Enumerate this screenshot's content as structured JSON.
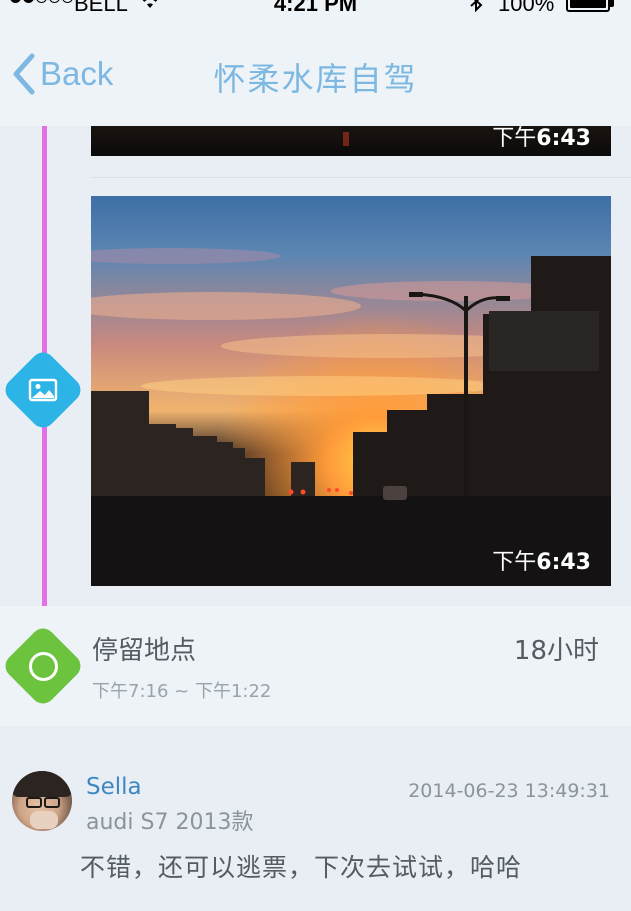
{
  "status_bar": {
    "carrier": "BELL",
    "time": "4:21 PM",
    "battery": "100%"
  },
  "nav": {
    "back_label": "Back",
    "title": "怀柔水库自驾"
  },
  "timeline": {
    "prev_photo": {
      "time_prefix": "下午",
      "time": "6:43"
    },
    "photo": {
      "time_prefix": "下午",
      "time": "6:43"
    },
    "stop": {
      "title": "停留地点",
      "duration": "18小时",
      "range": "下午7:16 ~ 下午1:22"
    }
  },
  "comment": {
    "author": "Sella",
    "timestamp": "2014-06-23 13:49:31",
    "car": "audi S7 2013款",
    "text": "不错，还可以逃票，下次去试试，哈哈"
  },
  "colors": {
    "accent": "#7db8e2",
    "timeline_pink": "#e26ee8",
    "image_marker": "#2cb4e6",
    "stop_marker": "#6cc33e",
    "author_name": "#3e88c2"
  },
  "icons": [
    "chevron-left-icon",
    "image-icon",
    "location-ring-icon",
    "wifi-icon",
    "bluetooth-icon",
    "battery-icon"
  ]
}
